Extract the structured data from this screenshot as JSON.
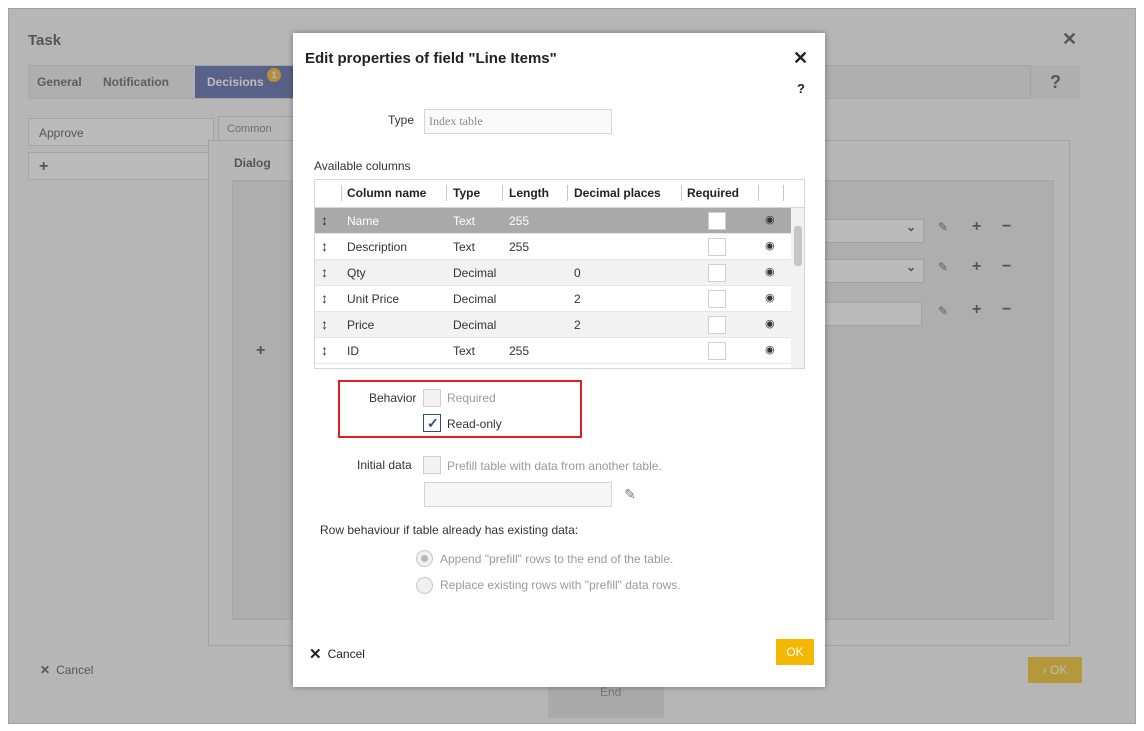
{
  "background": {
    "window_title": "Task",
    "tabs": [
      {
        "label": "General"
      },
      {
        "label": "Notification"
      },
      {
        "label": "Decisions",
        "badge": "1"
      }
    ],
    "sidebar_items": [
      "Approve",
      "+"
    ],
    "inner_tab": "Common",
    "dialog_label": "Dialog",
    "cancel_label": "Cancel",
    "ok_label": "› OK",
    "end_label": "End"
  },
  "modal": {
    "title": "Edit properties of field \"Line Items\"",
    "type_label": "Type",
    "type_value": "Index table",
    "available_columns_label": "Available columns",
    "columns_headers": [
      "Column name",
      "Type",
      "Length",
      "Decimal places",
      "Required"
    ],
    "rows": [
      {
        "name": "Name",
        "type": "Text",
        "length": "255",
        "decimal": ""
      },
      {
        "name": "Description",
        "type": "Text",
        "length": "255",
        "decimal": ""
      },
      {
        "name": "Qty",
        "type": "Decimal",
        "length": "",
        "decimal": "0"
      },
      {
        "name": "Unit Price",
        "type": "Decimal",
        "length": "",
        "decimal": "2"
      },
      {
        "name": "Price",
        "type": "Decimal",
        "length": "",
        "decimal": "2"
      },
      {
        "name": "ID",
        "type": "Text",
        "length": "255",
        "decimal": ""
      }
    ],
    "behavior_label": "Behavior",
    "required_label": "Required",
    "readonly_label": "Read-only",
    "readonly_checked": true,
    "initial_data_label": "Initial data",
    "prefill_label": "Prefill table with data from another table.",
    "row_behaviour_label": "Row behaviour if table already has existing data:",
    "append_label": "Append \"prefill\" rows to the end of the table.",
    "replace_label": "Replace existing rows with \"prefill\" data rows.",
    "cancel_label": "Cancel",
    "ok_label": "OK"
  }
}
